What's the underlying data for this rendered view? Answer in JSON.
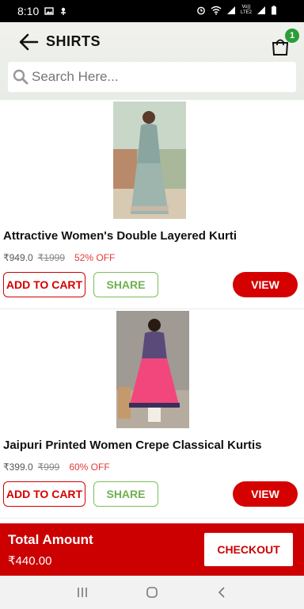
{
  "status_bar": {
    "time": "8:10",
    "network_label": "Vo)) LTE2"
  },
  "header": {
    "title": "SHIRTS",
    "cart_count": "1",
    "search": {
      "placeholder": "Search Here...",
      "value": ""
    }
  },
  "products": [
    {
      "name": "Attractive Women's Double Layered Kurti",
      "price": "₹949.0",
      "mrp": "₹1999",
      "discount": "52% OFF",
      "add_to_cart_label": "ADD TO CART",
      "share_label": "SHARE",
      "view_label": "VIEW"
    },
    {
      "name": "Jaipuri Printed Women Crepe Classical Kurtis",
      "price": "₹399.0",
      "mrp": "₹999",
      "discount": "60% OFF",
      "add_to_cart_label": "ADD TO CART",
      "share_label": "SHARE",
      "view_label": "VIEW"
    }
  ],
  "footer": {
    "total_label": "Total Amount",
    "total_value": "₹440.00",
    "checkout_label": "CHECKOUT"
  },
  "colors": {
    "accent": "#cc0000",
    "share_green": "#6fb04f",
    "badge_green": "#2a9d39"
  },
  "icons": [
    "back-arrow-icon",
    "cart-bag-icon",
    "search-icon",
    "recents-icon",
    "home-icon",
    "back-icon"
  ]
}
